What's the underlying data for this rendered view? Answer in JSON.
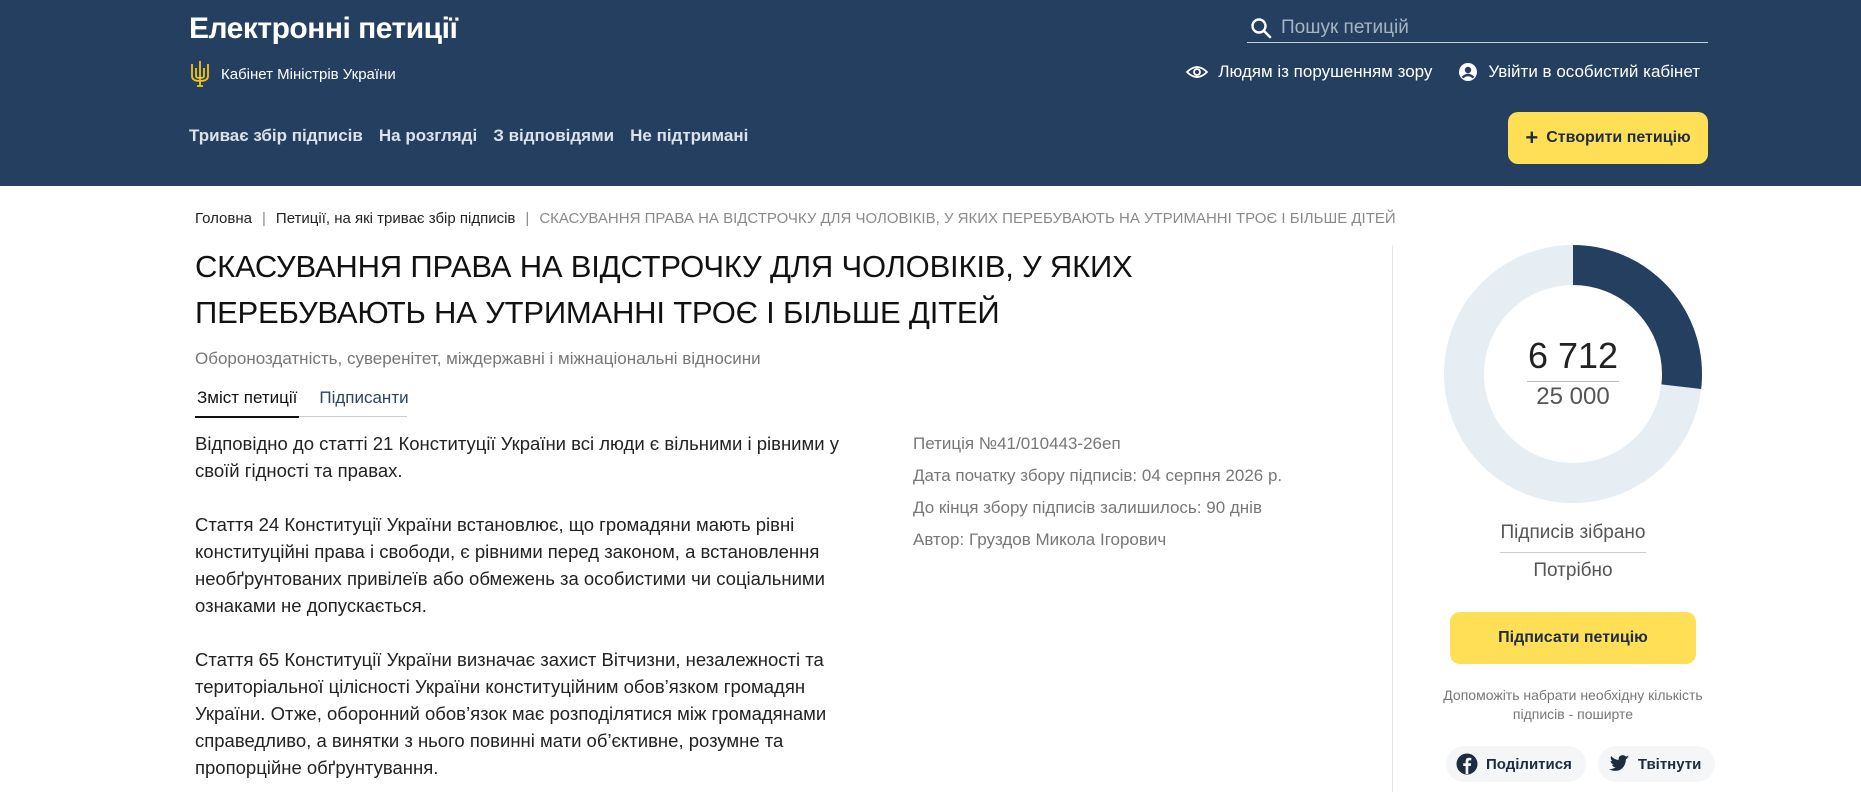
{
  "header": {
    "site_title": "Електронні петиції",
    "cabinet": "Кабінет Міністрів України",
    "search_placeholder": "Пошук петицій",
    "accessibility_link": "Людям із порушенням зору",
    "login_link": "Увійти в особистий кабінет",
    "nav": [
      "Триває збір підписів",
      "На розгляді",
      "З відповідями",
      "Не підтримані"
    ],
    "create_button": "Створити петицію",
    "colors": {
      "background": "#243f5f",
      "accent": "#fedf55"
    }
  },
  "breadcrumb": {
    "home": "Головна",
    "section": "Петиції, на які триває збір підписів",
    "current": "СКАСУВАННЯ ПРАВА НА ВІДСТРОЧКУ ДЛЯ ЧОЛОВІКІВ, У ЯКИХ ПЕРЕБУВАЮТЬ НА УТРИМАННІ ТРОЄ І БІЛЬШЕ ДІТЕЙ"
  },
  "petition": {
    "title": "СКАСУВАННЯ ПРАВА НА ВІДСТРОЧКУ ДЛЯ ЧОЛОВІКІВ, У ЯКИХ ПЕРЕБУВАЮТЬ НА УТРИМАННІ ТРОЄ І БІЛЬШЕ ДІТЕЙ",
    "category": "Обороноздатність, суверенітет, міждержавні і міжнаціональні відносини",
    "tabs": [
      "Зміст петиції",
      "Підписанти"
    ],
    "paragraphs": [
      "Відповідно до статті 21 Конституції України всі люди є вільними і рівними у своїй гідності та правах.",
      "Стаття 24 Конституції України встановлює, що громадяни мають рівні конституційні права і свободи, є рівними перед законом, а встановлення необґрунтованих привілеїв або обмежень за особистими чи соціальними ознаками не допускається.",
      "Стаття 65 Конституції України визначає захист Вітчизни, незалежності та територіальної цілісності України конституційним обов’язком громадян України. Отже, оборонний обов’язок має розподілятися між громадянами справедливо, а винятки з нього повинні мати об’єктивне, розумне та пропорційне обґрунтування."
    ],
    "meta": {
      "number": "Петиція №41/010443-26еп",
      "start_date": "Дата початку збору підписів: 04 серпня 2026 р.",
      "remaining": "До кінця збору підписів залишилось: 90 днів",
      "author": "Автор: Груздов Микола Ігорович"
    }
  },
  "signatures": {
    "current_label": "6 712",
    "target_label": "25 000",
    "current": 6712,
    "target": 25000,
    "collected_label": "Підписів зібрано",
    "needed_label": "Потрібно",
    "sign_button": "Підписати петицію",
    "share_hint": "Допоможіть набрати необхідну кількість підписів - поширте",
    "share_facebook": "Поділитися",
    "share_twitter": "Твітнути",
    "colors": {
      "progress": "#243f5f",
      "track": "#e6edf3"
    }
  }
}
